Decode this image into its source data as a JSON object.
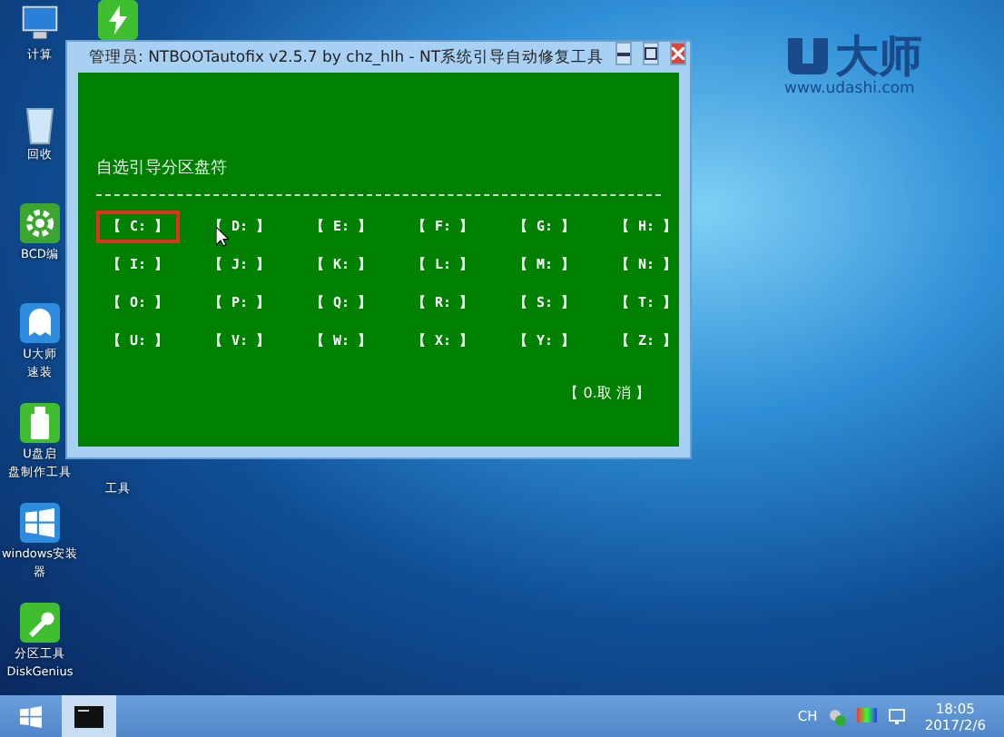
{
  "desktop_icons": [
    {
      "kind": "computer",
      "label": [
        "计算"
      ]
    },
    {
      "kind": "recycle",
      "label": [
        "回收"
      ]
    },
    {
      "kind": "gear",
      "label": [
        "BCD编"
      ]
    },
    {
      "kind": "ghost",
      "label": [
        "U大师",
        "速装"
      ]
    },
    {
      "kind": "usb",
      "label": [
        "U盘启",
        "盘制作工具"
      ]
    },
    {
      "kind": "windows",
      "label": [
        "windows安装",
        "器"
      ]
    },
    {
      "kind": "wrench",
      "label": [
        "分区工具",
        "DiskGenius"
      ]
    }
  ],
  "hidden_icon_label": "工具",
  "logo": {
    "name": "大师",
    "url": "www.udashi.com"
  },
  "window": {
    "title": "管理员:  NTBOOTautofix v2.5.7 by chz_hlh - NT系统引导自动修复工具",
    "heading": "自选引导分区盘符",
    "drives": [
      {
        "label": "【 C: 】",
        "selected": true
      },
      {
        "label": "【 D: 】",
        "selected": false
      },
      {
        "label": "【 E: 】",
        "selected": false
      },
      {
        "label": "【 F: 】",
        "selected": false
      },
      {
        "label": "【 G: 】",
        "selected": false
      },
      {
        "label": "【 H: 】",
        "selected": false
      },
      {
        "label": "【 I: 】",
        "selected": false
      },
      {
        "label": "【 J: 】",
        "selected": false
      },
      {
        "label": "【 K: 】",
        "selected": false
      },
      {
        "label": "【 L: 】",
        "selected": false
      },
      {
        "label": "【 M: 】",
        "selected": false
      },
      {
        "label": "【 N: 】",
        "selected": false
      },
      {
        "label": "【 O: 】",
        "selected": false
      },
      {
        "label": "【 P: 】",
        "selected": false
      },
      {
        "label": "【 Q: 】",
        "selected": false
      },
      {
        "label": "【 R: 】",
        "selected": false
      },
      {
        "label": "【 S: 】",
        "selected": false
      },
      {
        "label": "【 T: 】",
        "selected": false
      },
      {
        "label": "【 U: 】",
        "selected": false
      },
      {
        "label": "【 V: 】",
        "selected": false
      },
      {
        "label": "【 W: 】",
        "selected": false
      },
      {
        "label": "【 X: 】",
        "selected": false
      },
      {
        "label": "【 Y: 】",
        "selected": false
      },
      {
        "label": "【 Z: 】",
        "selected": false
      }
    ],
    "cancel": "【 0.取  消 】"
  },
  "taskbar": {
    "language": "CH",
    "time": "18:05",
    "date": "2017/2/6"
  }
}
